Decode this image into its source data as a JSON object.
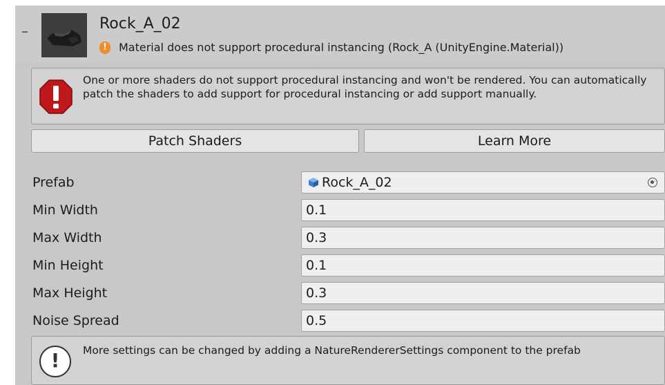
{
  "header": {
    "collapse_glyph": "–",
    "thumbnail_icon": "rock-thumbnail",
    "title": "Rock_A_02",
    "warning_icon": "warning-icon",
    "warning_text": "Material does not support procedural instancing (Rock_A (UnityEngine.Material))"
  },
  "error_box": {
    "icon": "error-stop-icon",
    "text": "One or more shaders do not support procedural instancing and won't be rendered. You can automatically patch the shaders to add support for procedural instancing or add support manually."
  },
  "buttons": {
    "patch": "Patch Shaders",
    "learn": "Learn More"
  },
  "fields": {
    "prefab": {
      "label": "Prefab",
      "value": "Rock_A_02",
      "icon": "prefab-cube-icon"
    },
    "min_width": {
      "label": "Min Width",
      "value": "0.1"
    },
    "max_width": {
      "label": "Max Width",
      "value": "0.3"
    },
    "min_height": {
      "label": "Min Height",
      "value": "0.1"
    },
    "max_height": {
      "label": "Max Height",
      "value": "0.3"
    },
    "noise_spread": {
      "label": "Noise Spread",
      "value": "0.5"
    }
  },
  "info_box": {
    "icon": "info-icon",
    "glyph": "!",
    "text": "More settings can be changed by adding a NatureRendererSettings component to the prefab"
  },
  "colors": {
    "panel_bg": "#c8c8c8",
    "field_bg": "#efefef",
    "error_red": "#c0171b",
    "warning_orange": "#ef8c2a",
    "prefab_blue": "#3a7fd0"
  }
}
